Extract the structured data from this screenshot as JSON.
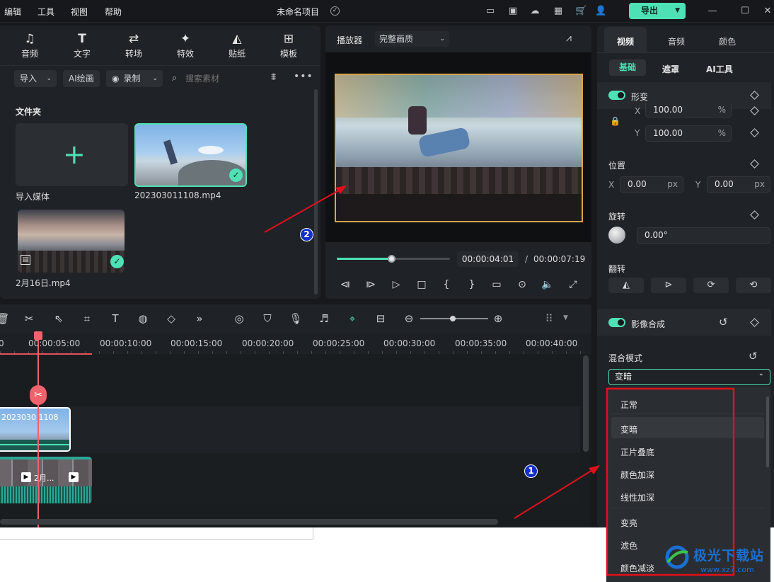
{
  "menu": [
    "编辑",
    "工具",
    "视图",
    "帮助"
  ],
  "project_title": "未命名项目",
  "export_label": "导出",
  "toolbar": [
    "音频",
    "文字",
    "转场",
    "特效",
    "贴纸",
    "模板"
  ],
  "filter_bar": {
    "import": "导入",
    "ai_paint": "AI绘画",
    "record": "录制",
    "search_placeholder": "搜索素材"
  },
  "media": {
    "folder_title": "文件夹",
    "import_label": "导入媒体",
    "clip1_name": "202303011108.mp4",
    "clip2_name": "2月16日.mp4"
  },
  "player": {
    "label": "播放器",
    "quality": "完整画质",
    "current_time": "00:00:04:01",
    "separator": "/",
    "total_time": "00:00:07:19",
    "progress": 0.48
  },
  "timeline": {
    "ticks": [
      "00:00:05:00",
      "00:00:10:00",
      "00:00:15:00",
      "00:00:20:00",
      "00:00:25:00",
      "00:00:30:00",
      "00:00:35:00",
      "00:00:40:00"
    ],
    "clip_video_label": "2023030 1108",
    "clip_audio_label": "2月..."
  },
  "right_panel": {
    "tabs": [
      "视频",
      "音频",
      "颜色"
    ],
    "subtabs": [
      "基础",
      "遮罩",
      "AI工具"
    ],
    "transform": "形变",
    "scale_x_label": "X",
    "scale_x": "100.00",
    "scale_y_label": "Y",
    "scale_y": "100.00",
    "percent": "%",
    "position": "位置",
    "pos_x_label": "X",
    "pos_x": "0.00",
    "pos_y_label": "Y",
    "pos_y": "0.00",
    "px": "px",
    "rotate": "旋转",
    "rotate_value": "0.00°",
    "flip": "翻转",
    "compositing": "影像合成",
    "blend_mode": "混合模式",
    "blend_value": "变暗"
  },
  "dropdown": [
    "正常",
    "变暗",
    "正片叠底",
    "颜色加深",
    "线性加深",
    "变亮",
    "滤色",
    "颜色减淡"
  ],
  "annotations": [
    "1",
    "2"
  ],
  "watermark": {
    "title": "极光下载站",
    "url": "www.xz7.com"
  },
  "colors": {
    "accent": "#4fe1b6",
    "annotation_red": "#e0101a",
    "playhead": "#f0626c"
  }
}
